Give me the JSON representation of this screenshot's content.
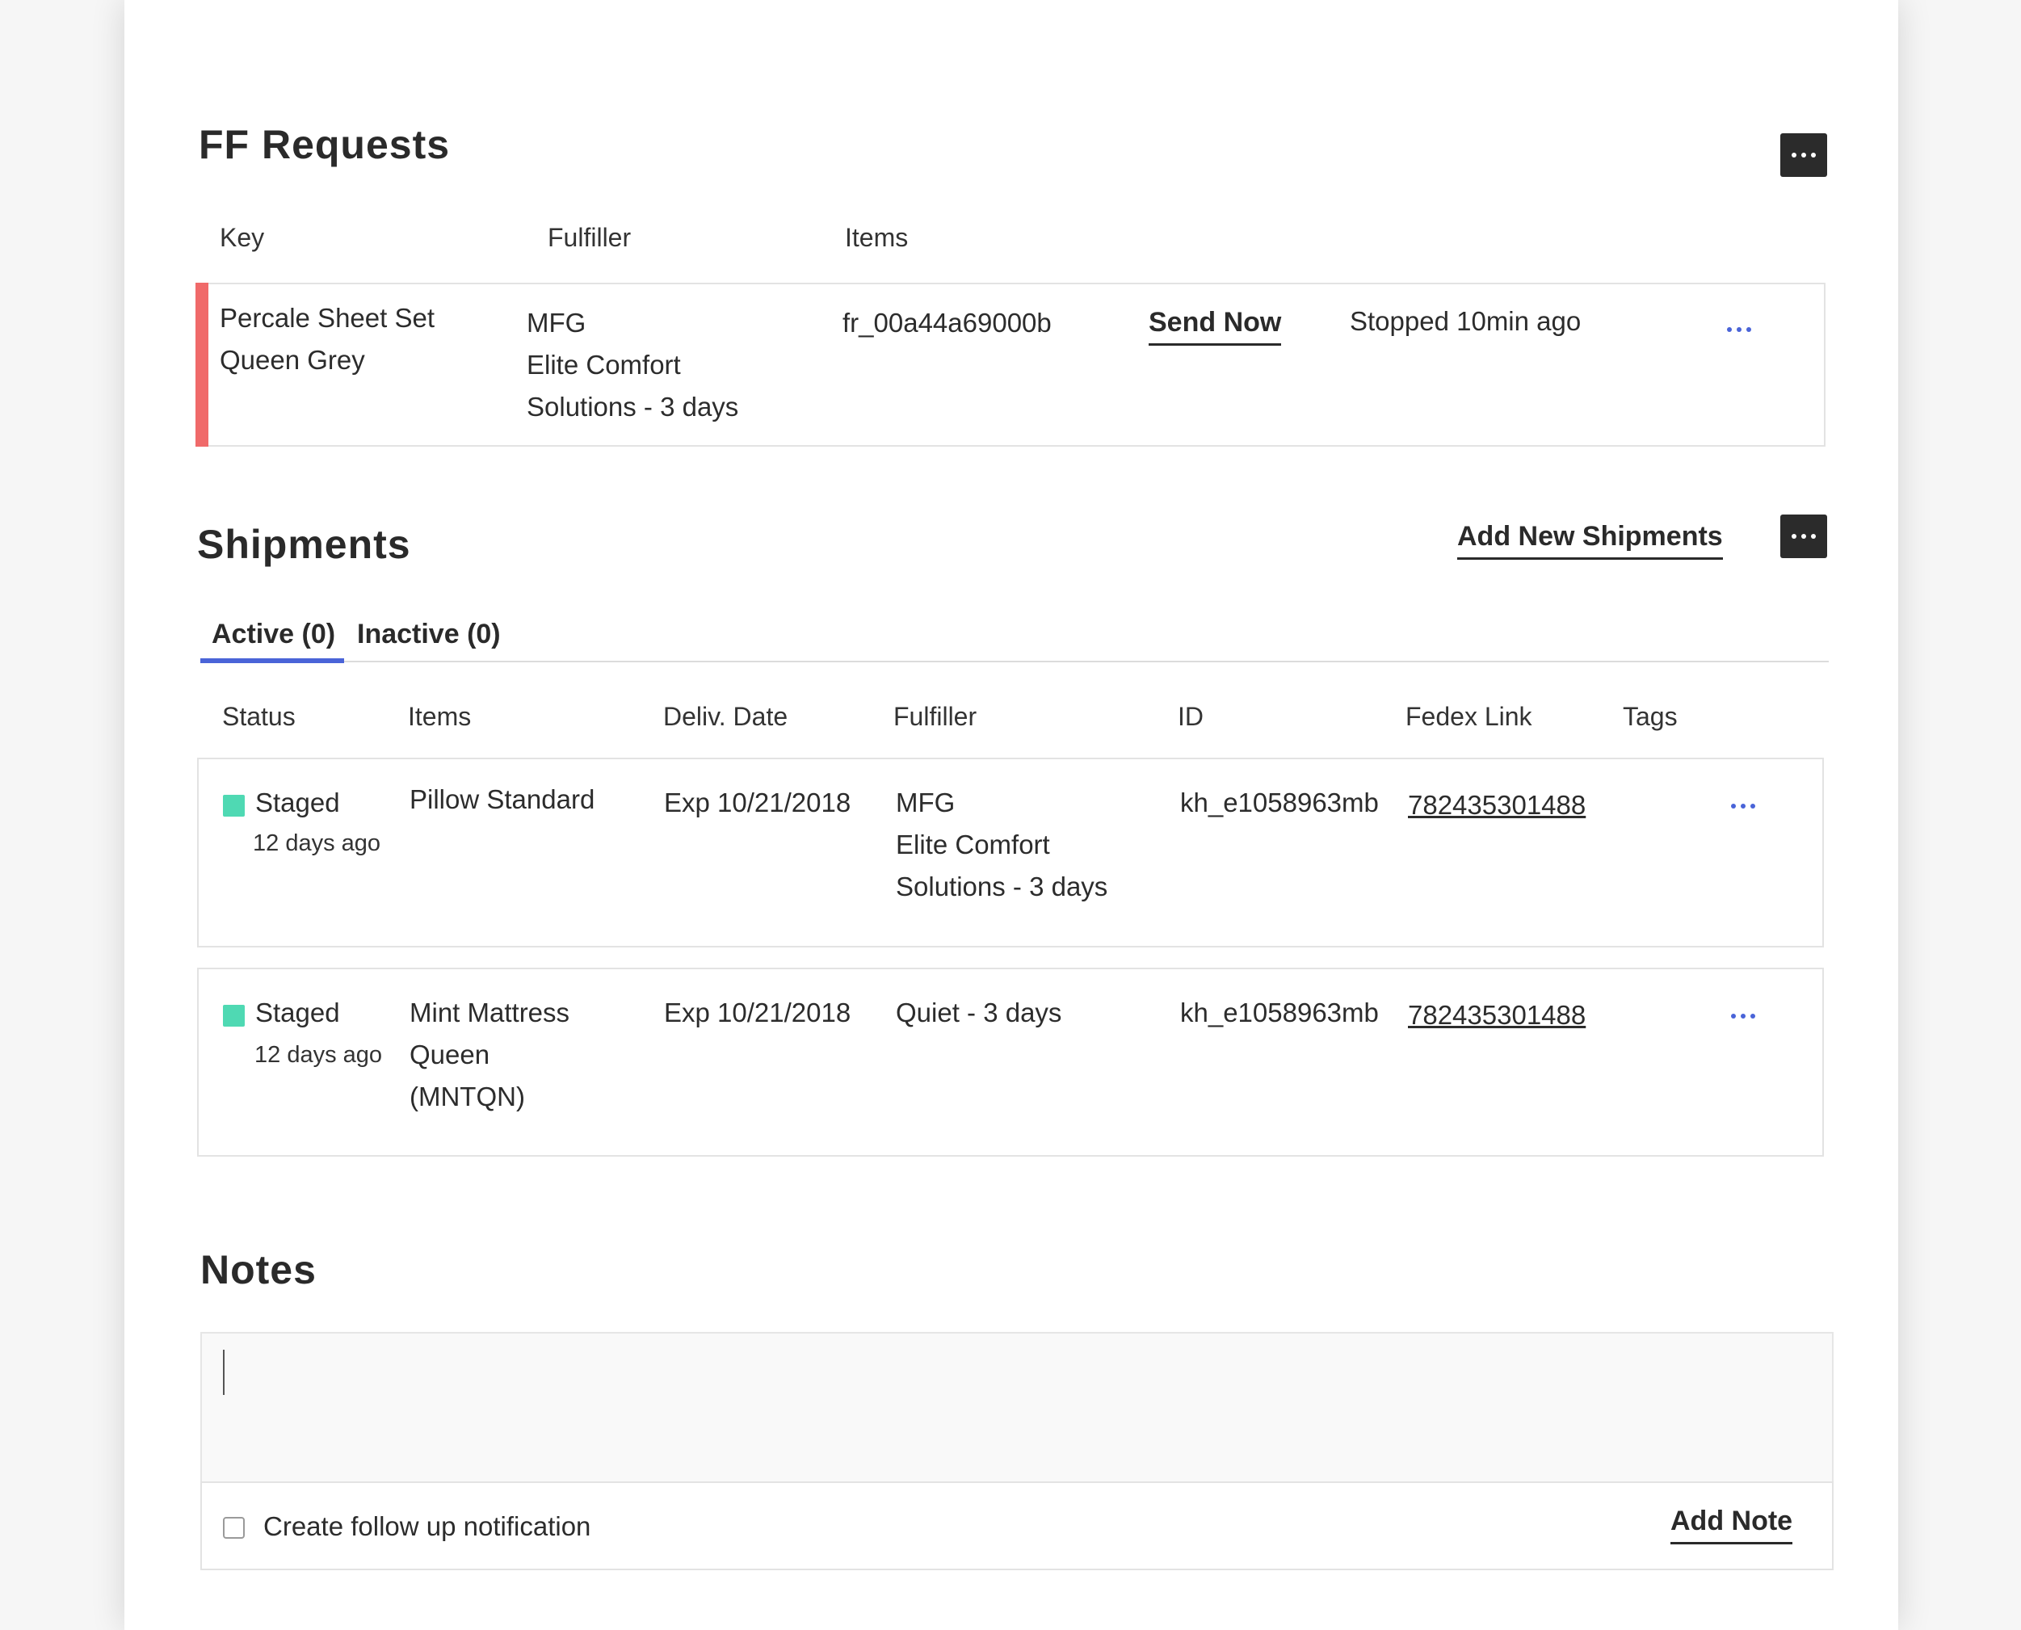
{
  "ff_requests": {
    "title": "FF Requests",
    "columns": [
      "Key",
      "Fulfiller",
      "Items"
    ],
    "rows": [
      {
        "key": [
          "Percale Sheet Set",
          "Queen Grey"
        ],
        "fulfiller": [
          "MFG",
          "Elite Comfort",
          "Solutions - 3 days"
        ],
        "items": "fr_00a44a69000b",
        "action": "Send Now",
        "status": "Stopped 10min ago",
        "accent_color": "#f06a6a"
      }
    ]
  },
  "shipments": {
    "title": "Shipments",
    "add_label": "Add New Shipments",
    "tabs": [
      {
        "label": "Active (0)",
        "active": true
      },
      {
        "label": "Inactive (0)",
        "active": false
      }
    ],
    "tab_accent_color": "#4a64d8",
    "columns": [
      "Status",
      "Items",
      "Deliv. Date",
      "Fulfiller",
      "ID",
      "Fedex Link",
      "Tags"
    ],
    "rows": [
      {
        "status": "Staged",
        "status_color": "#4fd9b3",
        "age": "12 days ago",
        "items": [
          "Pillow Standard"
        ],
        "deliv_date": "Exp 10/21/2018",
        "fulfiller": [
          "MFG",
          "Elite Comfort",
          "Solutions - 3 days"
        ],
        "id": "kh_e1058963mb",
        "fedex_link": "782435301488"
      },
      {
        "status": "Staged",
        "status_color": "#4fd9b3",
        "age": "12 days ago",
        "items": [
          "Mint Mattress",
          "Queen",
          "(MNTQN)"
        ],
        "deliv_date": "Exp 10/21/2018",
        "fulfiller": [
          "Quiet - 3 days"
        ],
        "id": "kh_e1058963mb",
        "fedex_link": "782435301488"
      }
    ]
  },
  "notes": {
    "title": "Notes",
    "input_value": "",
    "followup_label": "Create follow up notification",
    "followup_checked": false,
    "add_note_label": "Add Note"
  }
}
